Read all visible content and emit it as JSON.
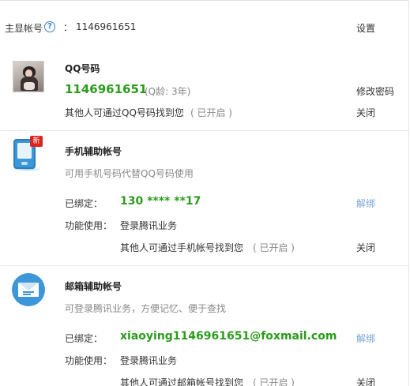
{
  "header": {
    "label": "主显帐号",
    "colon": "：",
    "account_value": "1146961651",
    "settings_label": "设置"
  },
  "qq_section": {
    "title": "QQ号码",
    "qq_number": "1146961651",
    "qq_age": "(Q龄: 3年)",
    "change_password_label": "修改密码",
    "findable_text": "其他人可通过QQ号码找到您",
    "findable_status": "( 已开启 )",
    "close_label": "关闭"
  },
  "phone_section": {
    "title": "手机辅助帐号",
    "new_badge": "新",
    "description": "可用手机号码代替QQ号码使用",
    "bound_label": "已绑定：",
    "bound_value": "130 **** **17",
    "unbind_label": "解绑",
    "feature_label": "功能使用：",
    "feature_value": "登录腾讯业务",
    "findable_text": "其他人可通过手机帐号找到您",
    "findable_status": "( 已开启 )",
    "close_label": "关闭"
  },
  "email_section": {
    "title": "邮箱辅助帐号",
    "description": "可登录腾讯业务，方便记忆、便于查找",
    "bound_label": "已绑定：",
    "bound_value": "xiaoying1146961651@foxmail.com",
    "unbind_label": "解绑",
    "feature_label": "功能使用：",
    "feature_value": "登录腾讯业务",
    "findable_text": "其他人可通过邮箱帐号找到您",
    "findable_status": "( 已开启 )",
    "close_label": "关闭"
  },
  "icons": {
    "help": "question-circle-icon",
    "phone": "mobile-phone-icon",
    "email": "envelope-icon"
  },
  "colors": {
    "accent_green": "#2a9c1b",
    "link_blue": "#7aa6d6",
    "icon_blue": "#3d96d8",
    "badge_red": "#d9251c"
  }
}
